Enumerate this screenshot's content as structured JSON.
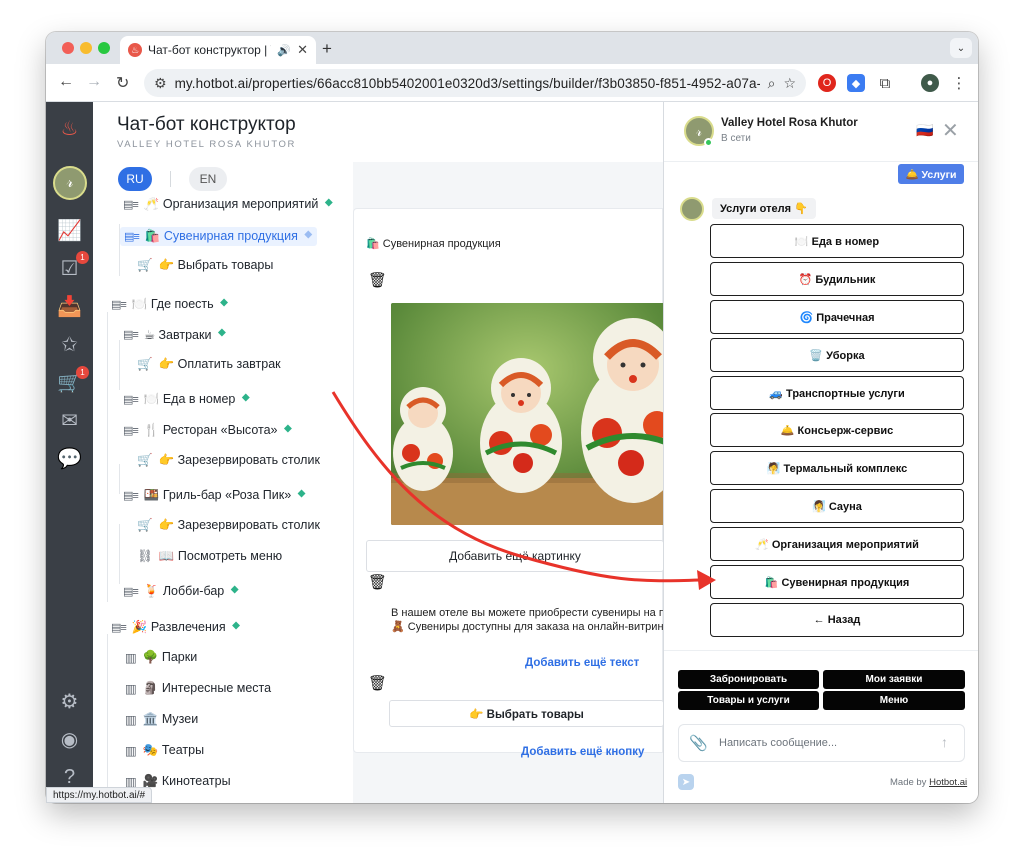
{
  "browser": {
    "tab_title": "Чат-бот конструктор | Va",
    "new_tab": "+",
    "url": "my.hotbot.ai/properties/66acc810bb5402001e0320d3/settings/builder/f3b03850-f851-4952-a07a-4...",
    "status_url": "https://my.hotbot.ai/#"
  },
  "rail": {
    "badge_tasks": "1",
    "badge_cart": "1"
  },
  "header": {
    "title": "Чат-бот конструктор",
    "subtitle": "VALLEY HOTEL ROSA KHUTOR",
    "lang_ru": "RU",
    "lang_en": "EN"
  },
  "tree": {
    "items": [
      {
        "prefix": "▤≡",
        "label": "🥂 Организация мероприятий",
        "tag": "⯁"
      },
      {
        "prefix": "▤≡",
        "label": "🛍️ Сувенирная продукция",
        "tag": "⯁"
      },
      {
        "prefix": "🛒",
        "label": "👉 Выбрать товары",
        "tag": ""
      },
      {
        "prefix": "▤≡",
        "label": "🍽️ Где поесть",
        "tag": "⯁"
      },
      {
        "prefix": "▤≡",
        "label": "☕ Завтраки",
        "tag": "⯁"
      },
      {
        "prefix": "🛒",
        "label": "👉 Оплатить завтрак",
        "tag": ""
      },
      {
        "prefix": "▤≡",
        "label": "🍽️ Еда в номер",
        "tag": "⯁"
      },
      {
        "prefix": "▤≡",
        "label": "🍴 Ресторан «Высота»",
        "tag": "⯁"
      },
      {
        "prefix": "🛒",
        "label": "👉 Зарезервировать столик",
        "tag": ""
      },
      {
        "prefix": "▤≡",
        "label": "🍱 Гриль-бар «Роза Пик»",
        "tag": "⯁"
      },
      {
        "prefix": "🛒",
        "label": "👉 Зарезервировать столик",
        "tag": ""
      },
      {
        "prefix": "⛓",
        "label": "📖 Посмотреть меню",
        "tag": ""
      },
      {
        "prefix": "▤≡",
        "label": "🍹 Лобби-бар",
        "tag": "⯁"
      },
      {
        "prefix": "▤≡",
        "label": "🎉 Развлечения",
        "tag": "⯁"
      },
      {
        "prefix": "▥",
        "label": "🌳 Парки",
        "tag": ""
      },
      {
        "prefix": "▥",
        "label": "🗿 Интересные места",
        "tag": ""
      },
      {
        "prefix": "▥",
        "label": "🏛️ Музеи",
        "tag": ""
      },
      {
        "prefix": "▥",
        "label": "🎭 Театры",
        "tag": ""
      },
      {
        "prefix": "▥",
        "label": "🎥 Кинотеатры",
        "tag": ""
      }
    ]
  },
  "editor": {
    "block_title": "🛍️ Сувенирная продукция",
    "add_image": "Добавить ещё картинку",
    "text_line1": "В нашем отеле вы можете приобрести сувениры на па",
    "text_line2": "🧸 Сувениры доступны для заказа на онлайн-витрине.",
    "add_text": "Добавить ещё текст",
    "button_label": "👉 Выбрать товары",
    "add_button": "Добавить ещё кнопку"
  },
  "chat": {
    "hotel_name": "Valley Hotel Rosa Khutor",
    "online": "В сети",
    "flag": "🇷🇺",
    "user_msg": "🛎️ Услуги",
    "bot_msg": "Услуги отеля 👇",
    "options": [
      "🍽️ Еда в номер",
      "⏰ Будильник",
      "🌀 Прачечная",
      "🗑️ Уборка",
      "🚙 Транспортные услуги",
      "🛎️ Консьерж-сервис",
      "🧖 Термальный комплекс",
      "🧖‍♀️ Сауна",
      "🥂 Организация мероприятий",
      "🛍️ Сувенирная продукция",
      "← Назад"
    ],
    "quick": [
      "Забронировать",
      "Мои заявки",
      "Товары и услуги",
      "Меню"
    ],
    "input_placeholder": "Написать сообщение...",
    "made_by_prefix": "Made by ",
    "made_by_link": "Hotbot.ai"
  },
  "colors": {
    "accent": "#2f6fe4",
    "rail": "#3a3f46",
    "arrow": "#e8332a",
    "tag": "#2db38a"
  }
}
